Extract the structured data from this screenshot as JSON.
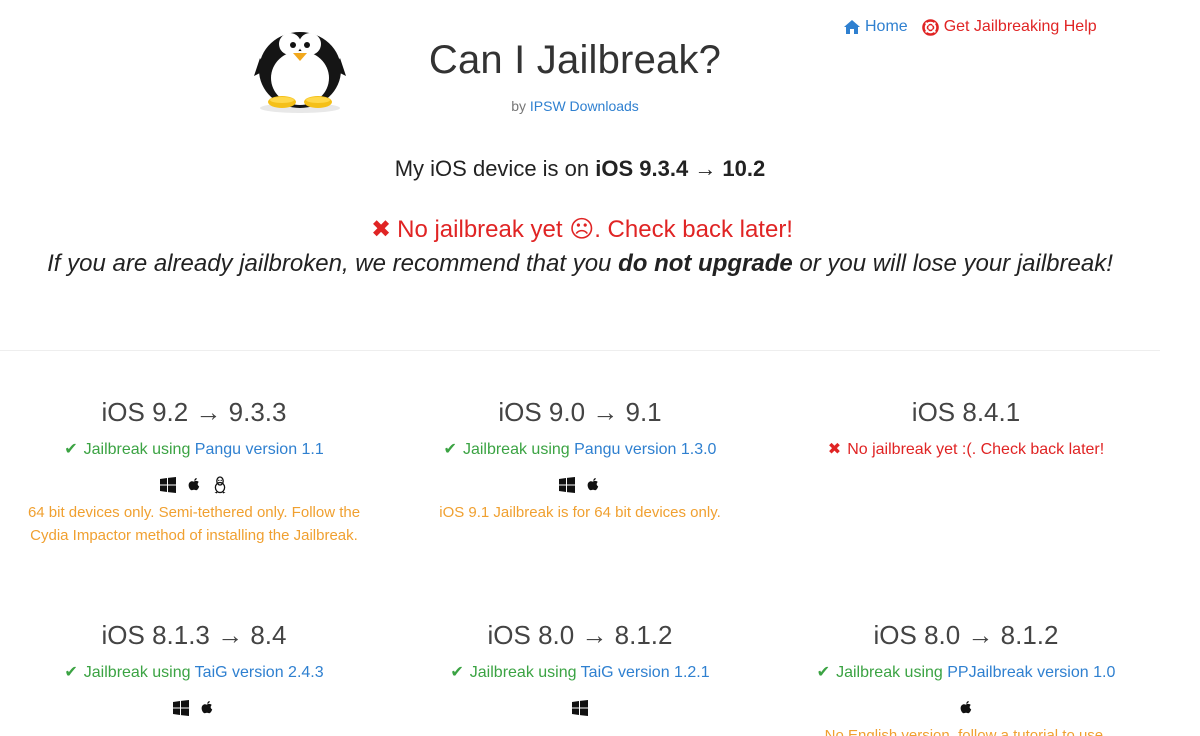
{
  "nav": {
    "home_label": "Home",
    "help_label": "Get Jailbreaking Help"
  },
  "header": {
    "title": "Can I Jailbreak?",
    "by_prefix": "by",
    "by_link": "IPSW Downloads"
  },
  "device": {
    "prefix": "My iOS device is on",
    "version": "iOS 9.3.4 → 10.2"
  },
  "status": {
    "message": "No jailbreak yet ☹. Check back later!",
    "advice_before": "If you are already jailbroken, we recommend that you",
    "advice_bold": "do not upgrade",
    "advice_after": "or you will lose your jailbreak!"
  },
  "versions": [
    {
      "title": "iOS 9.2 → 9.3.3",
      "status": "ok",
      "prefix": "Jailbreak using",
      "tool": "Pangu version 1.1",
      "platforms": [
        "windows",
        "apple",
        "linux"
      ],
      "note": "64 bit devices only. Semi-tethered only. Follow the Cydia Impactor method of installing the Jailbreak."
    },
    {
      "title": "iOS 9.0 → 9.1",
      "status": "ok",
      "prefix": "Jailbreak using",
      "tool": "Pangu version 1.3.0",
      "platforms": [
        "windows",
        "apple"
      ],
      "note": "iOS 9.1 Jailbreak is for 64 bit devices only."
    },
    {
      "title": "iOS 8.4.1",
      "status": "none",
      "message": "No jailbreak yet :(. Check back later!"
    },
    {
      "title": "iOS 8.1.3 → 8.4",
      "status": "ok",
      "prefix": "Jailbreak using",
      "tool": "TaiG version 2.4.3",
      "platforms": [
        "windows",
        "apple"
      ]
    },
    {
      "title": "iOS 8.0 → 8.1.2",
      "status": "ok",
      "prefix": "Jailbreak using",
      "tool": "TaiG version 1.2.1",
      "platforms": [
        "windows"
      ]
    },
    {
      "title": "iOS 8.0 → 8.1.2",
      "status": "ok",
      "prefix": "Jailbreak using",
      "tool": "PPJailbreak version 1.0",
      "platforms": [
        "apple"
      ],
      "note": "No English version, follow a tutorial to use."
    }
  ],
  "colors": {
    "link_blue": "#2f80d0",
    "error_red": "#e02424",
    "success_green": "#3ba343",
    "note_orange": "#f0a030"
  }
}
